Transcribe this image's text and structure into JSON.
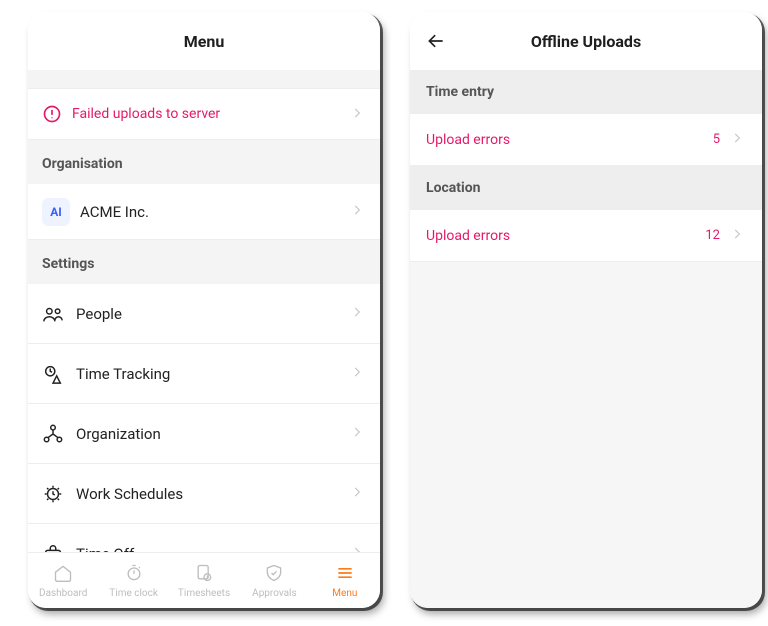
{
  "left": {
    "title": "Menu",
    "alert_label": "Failed uploads to server",
    "section_org": "Organisation",
    "org_initials": "AI",
    "org_name": "ACME Inc.",
    "section_settings": "Settings",
    "settings": {
      "people": "People",
      "time_tracking": "Time Tracking",
      "organization": "Organization",
      "work_schedules": "Work Schedules",
      "time_off": "Time Off"
    },
    "tabs": {
      "dashboard": "Dashboard",
      "time_clock": "Time clock",
      "timesheets": "Timesheets",
      "approvals": "Approvals",
      "menu": "Menu"
    }
  },
  "right": {
    "title": "Offline Uploads",
    "section_time_entry": "Time entry",
    "time_entry_label": "Upload errors",
    "time_entry_count": "5",
    "section_location": "Location",
    "location_label": "Upload errors",
    "location_count": "12"
  }
}
